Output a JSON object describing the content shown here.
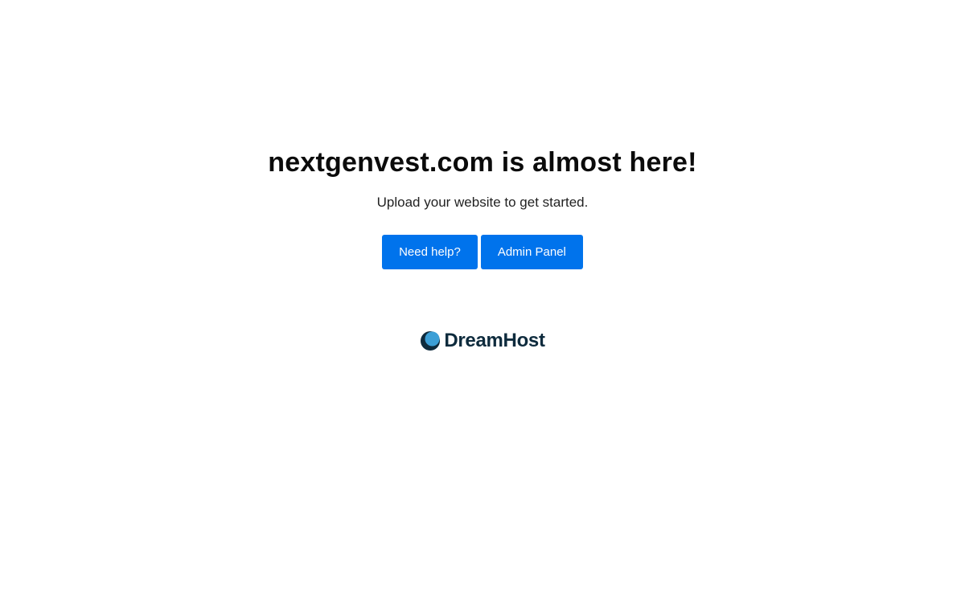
{
  "main": {
    "headline": "nextgenvest.com is almost here!",
    "subtitle": "Upload your website to get started.",
    "buttons": {
      "help_label": "Need help?",
      "admin_label": "Admin Panel"
    }
  },
  "footer": {
    "logo_icon": "crescent-moon-icon",
    "logo_text": "DreamHost"
  },
  "colors": {
    "button_bg": "#0073ec",
    "button_text": "#ffffff",
    "logo_text": "#0e2b3d",
    "logo_moon_dark": "#0e2b3d",
    "logo_moon_light": "#3c9fd6"
  }
}
